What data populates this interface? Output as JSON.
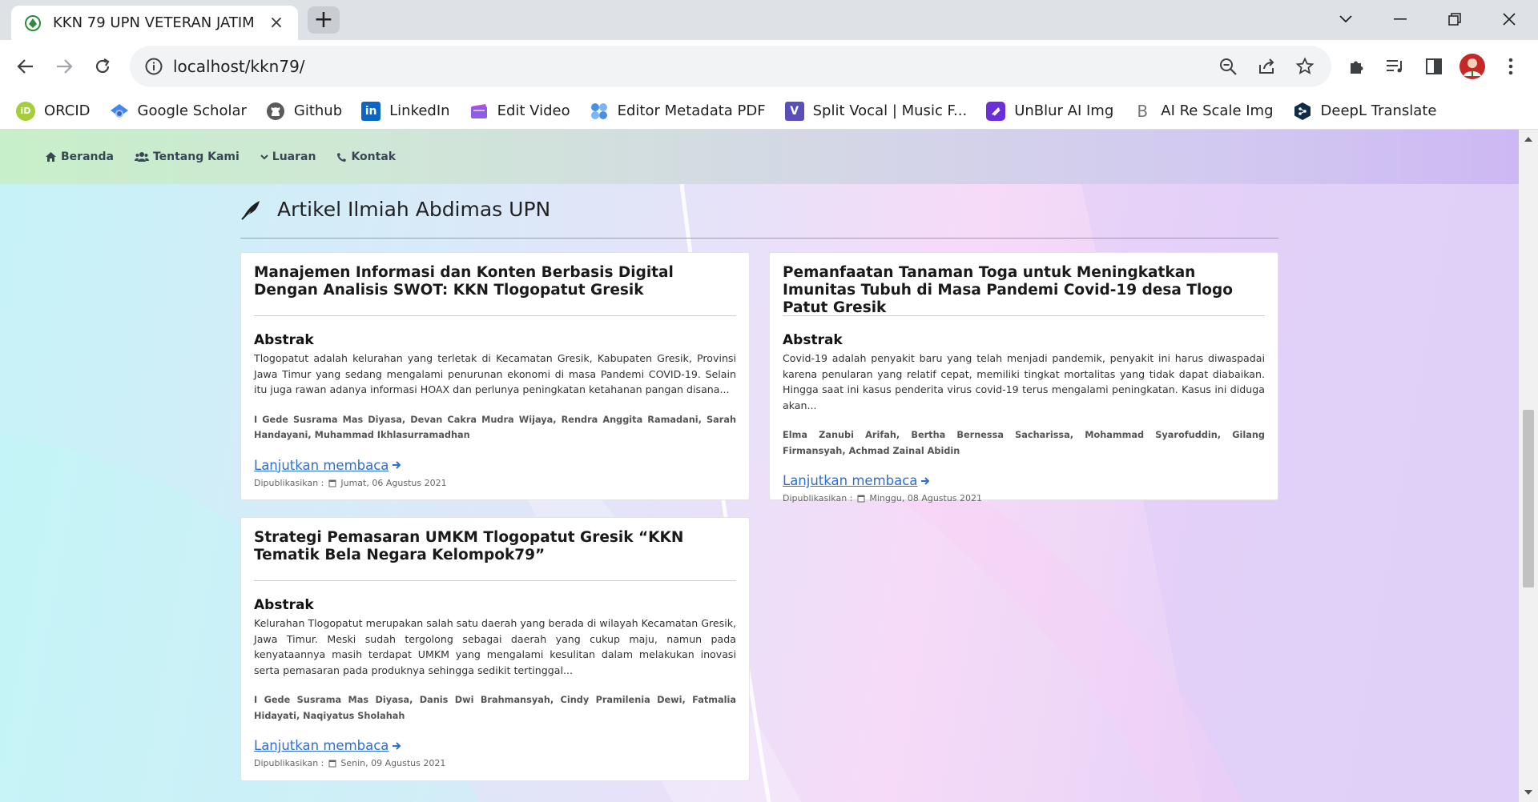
{
  "browser": {
    "tab_title": "KKN 79 UPN VETERAN JATIM",
    "tab_close": "×",
    "new_tab": "+",
    "url": "localhost/kkn79/",
    "bookmarks": [
      {
        "label": "ORCID",
        "icon": "orcid-icon",
        "color": "#a6ce39",
        "glyph": "iD"
      },
      {
        "label": "Google Scholar",
        "icon": "google-scholar-icon",
        "color": "#4285f4",
        "glyph": ""
      },
      {
        "label": "Github",
        "icon": "github-icon",
        "color": "#5b5b5b",
        "glyph": ""
      },
      {
        "label": "LinkedIn",
        "icon": "linkedin-icon",
        "color": "#0a66c2",
        "glyph": "in"
      },
      {
        "label": "Edit Video",
        "icon": "edit-video-icon",
        "color": "#7b4fd6",
        "glyph": ""
      },
      {
        "label": "Editor Metadata PDF",
        "icon": "metadata-pdf-icon",
        "color": "#4a90e2",
        "glyph": ""
      },
      {
        "label": "Split Vocal | Music F...",
        "icon": "split-vocal-icon",
        "color": "#5a4fb8",
        "glyph": "V"
      },
      {
        "label": "UnBlur AI Img",
        "icon": "unblur-icon",
        "color": "#6b2fd9",
        "glyph": ""
      },
      {
        "label": "AI Re Scale Img",
        "icon": "rescale-icon",
        "color": "#ffffff",
        "glyph": "B"
      },
      {
        "label": "DeepL Translate",
        "icon": "deepl-icon",
        "color": "#0f2b46",
        "glyph": ""
      }
    ]
  },
  "site_nav": {
    "items": [
      {
        "label": "Beranda",
        "icon": "home-icon"
      },
      {
        "label": "Tentang Kami",
        "icon": "users-icon"
      },
      {
        "label": "Luaran",
        "icon": "chevron-down-icon"
      },
      {
        "label": "Kontak",
        "icon": "phone-icon"
      }
    ]
  },
  "section": {
    "title": "Artikel Ilmiah Abdimas UPN",
    "icon": "feather-icon"
  },
  "common": {
    "abstract_heading": "Abstrak",
    "read_more": "Lanjutkan membaca",
    "published_label": "Dipublikasikan :"
  },
  "articles": [
    {
      "title": "Manajemen Informasi dan Konten Berbasis Digital Dengan Analisis SWOT: KKN Tlogopatut Gresik",
      "abstract": "Tlogopatut adalah kelurahan yang terletak di Kecamatan Gresik, Kabupaten Gresik, Provinsi Jawa Timur yang sedang mengalami penurunan ekonomi di masa Pandemi COVID-19. Selain itu juga rawan adanya informasi HOAX dan perlunya peningkatan ketahanan pangan disana...",
      "authors": "I Gede Susrama Mas Diyasa, Devan Cakra Mudra Wijaya, Rendra Anggita Ramadani, Sarah Handayani, Muhammad Ikhlasurramadhan",
      "date": "Jumat, 06 Agustus 2021"
    },
    {
      "title": "Pemanfaatan Tanaman Toga untuk Meningkatkan Imunitas Tubuh di Masa Pandemi Covid-19 desa Tlogo Patut Gresik",
      "abstract": "Covid-19 adalah penyakit baru yang telah menjadi pandemik, penyakit ini harus diwaspadai karena penularan yang relatif cepat, memiliki tingkat mortalitas yang tidak dapat diabaikan. Hingga saat ini kasus penderita virus covid-19 terus mengalami peningkatan. Kasus ini diduga akan...",
      "authors": "Elma Zanubi Arifah, Bertha Bernessa Sacharissa, Mohammad Syarofuddin, Gilang Firmansyah, Achmad Zainal Abidin",
      "date": "Minggu, 08 Agustus 2021"
    },
    {
      "title": "Strategi Pemasaran UMKM Tlogopatut Gresik “KKN Tematik Bela Negara Kelompok79”",
      "abstract": "Kelurahan Tlogopatut merupakan salah satu daerah yang berada di wilayah Kecamatan Gresik, Jawa Timur. Meski sudah tergolong sebagai daerah yang cukup maju, namun pada kenyataannya masih terdapat UMKM yang mengalami kesulitan dalam melakukan inovasi serta pemasaran pada produknya sehingga sedikit tertinggal...",
      "authors": "I Gede Susrama Mas Diyasa, Danis Dwi Brahmansyah, Cindy Pramilenia Dewi, Fatmalia Hidayati, Naqiyatus Sholahah",
      "date": "Senin, 09 Agustus 2021"
    }
  ]
}
